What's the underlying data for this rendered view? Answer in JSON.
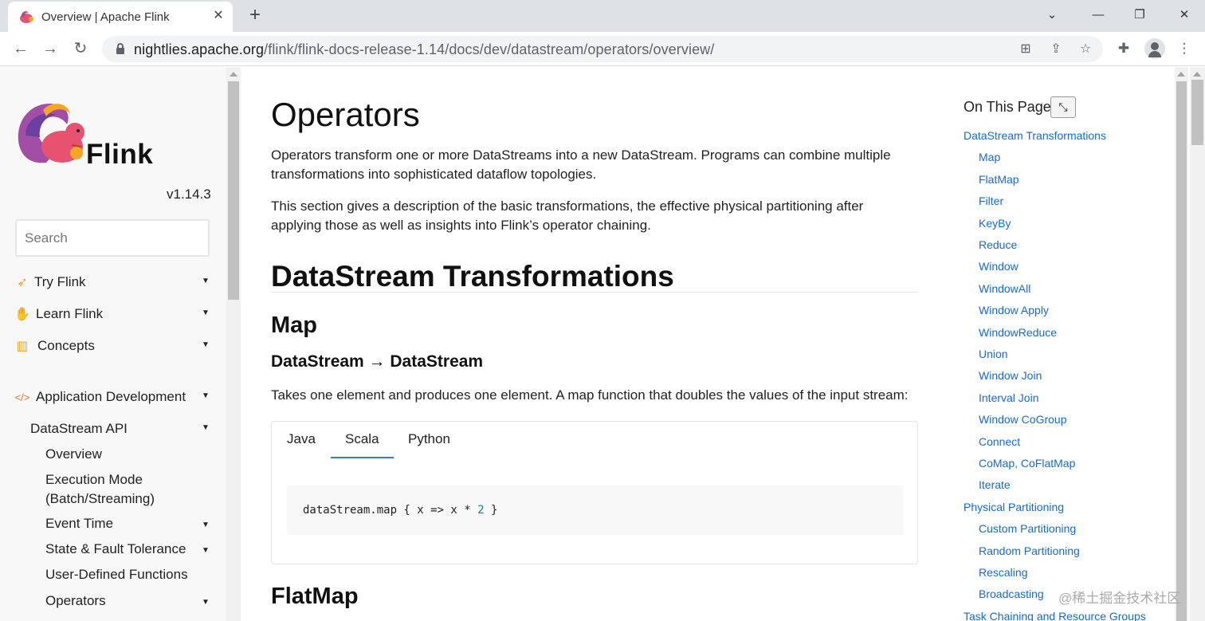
{
  "browser": {
    "tab_title": "Overview | Apache Flink",
    "close_tab": "✕",
    "new_tab": "+",
    "url_host": "nightlies.apache.org",
    "url_path": "/flink/flink-docs-release-1.14/docs/dev/datastream/operators/overview/",
    "window_minimize": "—",
    "window_restore": "❐",
    "window_close": "✕",
    "tab_search": "⌄"
  },
  "sidebar": {
    "logo_text": "Flink",
    "version": "v1.14.3",
    "search_placeholder": "Search",
    "sections": [
      {
        "label": "Try Flink",
        "icon": "rocket-icon"
      },
      {
        "label": "Learn Flink",
        "icon": "hand-icon"
      },
      {
        "label": "Concepts",
        "icon": "map-icon"
      },
      {
        "label": "Application Development",
        "icon": "code-icon"
      }
    ],
    "datastream_api": "DataStream API",
    "sub_items": [
      "Overview",
      "Execution Mode (Batch/Streaming)",
      "Event Time",
      "State & Fault Tolerance",
      "User-Defined Functions",
      "Operators"
    ],
    "arrow": "▼"
  },
  "main": {
    "title": "Operators",
    "intro1": "Operators transform one or more DataStreams into a new DataStream. Programs can combine multiple transformations into sophisticated dataflow topologies.",
    "intro2": "This section gives a description of the basic transformations, the effective physical partitioning after applying those as well as insights into Flink’s operator chaining.",
    "h2": "DataStream Transformations",
    "h3_map": "Map",
    "h4_map": "DataStream → DataStream",
    "map_desc": "Takes one element and produces one element. A map function that doubles the values of the input stream:",
    "code_tabs": [
      "Java",
      "Scala",
      "Python"
    ],
    "active_tab": "Scala",
    "code_prefix": "dataStream.map { x => x * ",
    "code_num": "2",
    "code_suffix": " }",
    "h3_flatmap": "FlatMap"
  },
  "toc": {
    "title": "On This Page",
    "toggle": "⤡",
    "links": [
      {
        "label": "DataStream Transformations",
        "level": 1
      },
      {
        "label": "Map",
        "level": 2
      },
      {
        "label": "FlatMap",
        "level": 2
      },
      {
        "label": "Filter",
        "level": 2
      },
      {
        "label": "KeyBy",
        "level": 2
      },
      {
        "label": "Reduce",
        "level": 2
      },
      {
        "label": "Window",
        "level": 2
      },
      {
        "label": "WindowAll",
        "level": 2
      },
      {
        "label": "Window Apply",
        "level": 2
      },
      {
        "label": "WindowReduce",
        "level": 2
      },
      {
        "label": "Union",
        "level": 2
      },
      {
        "label": "Window Join",
        "level": 2
      },
      {
        "label": "Interval Join",
        "level": 2
      },
      {
        "label": "Window CoGroup",
        "level": 2
      },
      {
        "label": "Connect",
        "level": 2
      },
      {
        "label": "CoMap, CoFlatMap",
        "level": 2
      },
      {
        "label": "Iterate",
        "level": 2
      },
      {
        "label": "Physical Partitioning",
        "level": 1
      },
      {
        "label": "Custom Partitioning",
        "level": 2
      },
      {
        "label": "Random Partitioning",
        "level": 2
      },
      {
        "label": "Rescaling",
        "level": 2
      },
      {
        "label": "Broadcasting",
        "level": 2
      },
      {
        "label": "Task Chaining and Resource Groups",
        "level": 1
      }
    ]
  },
  "watermark": "@稀土掘金技术社区",
  "colors": {
    "link": "#1a6ac2",
    "tab_underline": "#3c7cb7"
  }
}
